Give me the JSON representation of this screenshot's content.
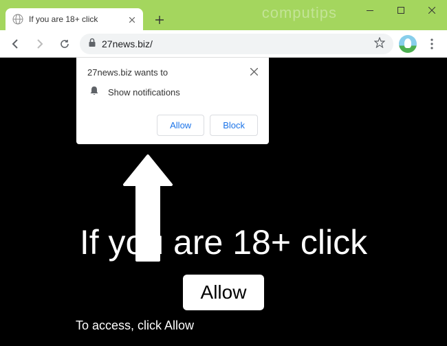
{
  "watermark": "computips",
  "tab": {
    "title": "If you are 18+ click"
  },
  "address": {
    "url": "27news.biz/"
  },
  "permission": {
    "origin_text": "27news.biz wants to",
    "capability": "Show notifications",
    "allow_label": "Allow",
    "block_label": "Block"
  },
  "page": {
    "headline": "If you are 18+ click",
    "allow_button": "Allow",
    "subtext": "To access, click Allow"
  }
}
